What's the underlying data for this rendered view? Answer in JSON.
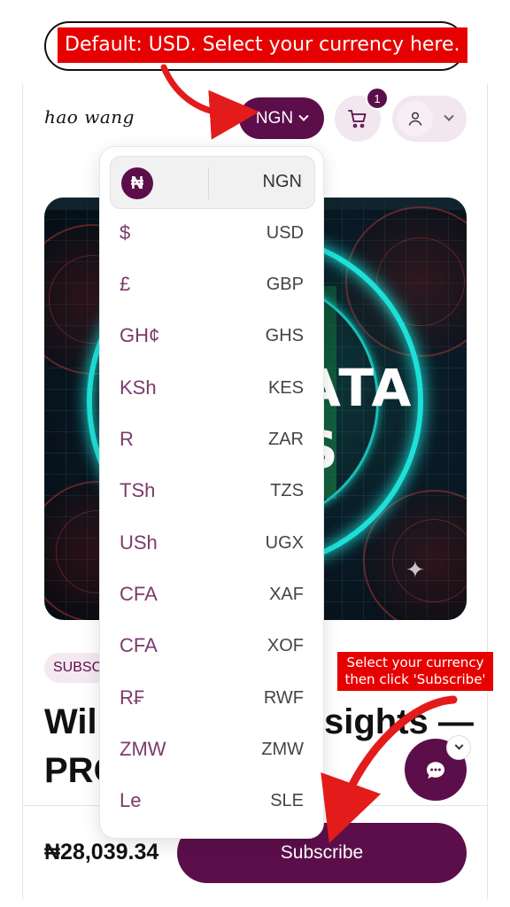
{
  "callouts": {
    "top": "Default: USD. Select your currency here.",
    "bottom_line1": "Select your currency",
    "bottom_line2": "then click 'Subscribe'"
  },
  "header": {
    "logo": "hao wang",
    "currency_label": "NGN",
    "cart_count": "1"
  },
  "hero": {
    "visible_text": "ATA\nS"
  },
  "product": {
    "badge": "SUBSC",
    "title_line1_left": "Wil",
    "title_line1_right": "sights —",
    "title_line2": "PRO",
    "price": "₦28,039.34",
    "subscribe_label": "Subscribe"
  },
  "currency_dropdown": {
    "selected": {
      "symbol": "₦",
      "code": "NGN"
    },
    "options": [
      {
        "symbol": "$",
        "code": "USD"
      },
      {
        "symbol": "£",
        "code": "GBP"
      },
      {
        "symbol": "GH¢",
        "code": "GHS"
      },
      {
        "symbol": "KSh",
        "code": "KES"
      },
      {
        "symbol": "R",
        "code": "ZAR"
      },
      {
        "symbol": "TSh",
        "code": "TZS"
      },
      {
        "symbol": "USh",
        "code": "UGX"
      },
      {
        "symbol": "CFA",
        "code": "XAF"
      },
      {
        "symbol": "CFA",
        "code": "XOF"
      },
      {
        "symbol": "R₣",
        "code": "RWF"
      },
      {
        "symbol": "ZMW",
        "code": "ZMW"
      },
      {
        "symbol": "Le",
        "code": "SLE"
      }
    ]
  },
  "colors": {
    "brand": "#5c0e4b",
    "callout_red": "#e60000",
    "accent_cyan": "#1de0d8"
  },
  "icons": {
    "cart": "cart-icon",
    "user": "user-icon",
    "chat": "chat-icon",
    "chevron": "chevron-down-icon"
  }
}
